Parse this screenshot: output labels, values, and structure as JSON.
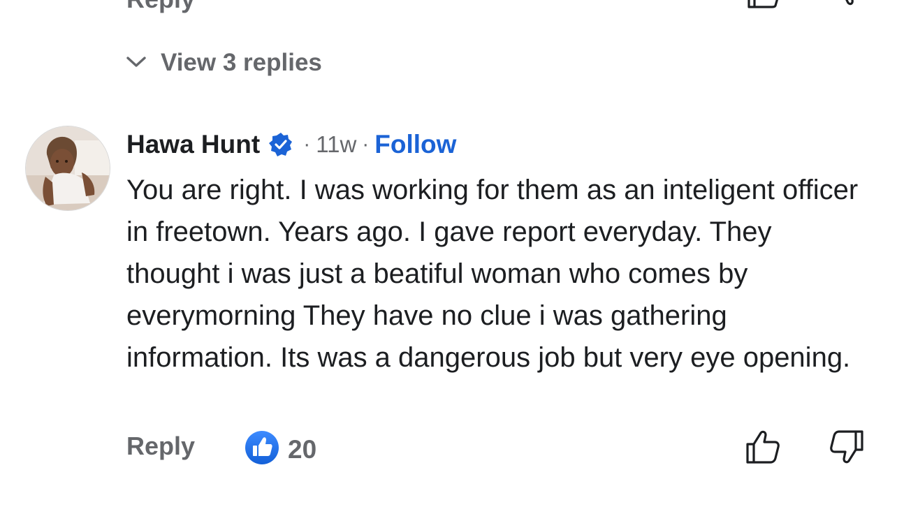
{
  "previous_comment": {
    "reply_label": "Reply"
  },
  "view_replies": {
    "label": "View 3 replies"
  },
  "comment": {
    "author": "Hawa Hunt",
    "verified": true,
    "separator": "·",
    "timestamp": "11w",
    "follow_label": "Follow",
    "body": "You are right. I was working for them as an inteligent officer in freetown. Years ago. I gave report everyday. They thought i was just a beatiful woman who comes by everymorning They have no clue i was gathering information. Its was a dangerous job but very eye opening.",
    "reply_label": "Reply",
    "like_count": "20"
  },
  "icons": {
    "verified": "verified-badge-icon",
    "chevron": "chevron-down-icon",
    "reaction": "like-reaction-icon",
    "like": "thumbs-up-outline-icon",
    "dislike": "thumbs-down-outline-icon"
  },
  "colors": {
    "accent_blue": "#1b63d6",
    "muted_text": "#65676b",
    "body_text": "#1c1e21"
  }
}
